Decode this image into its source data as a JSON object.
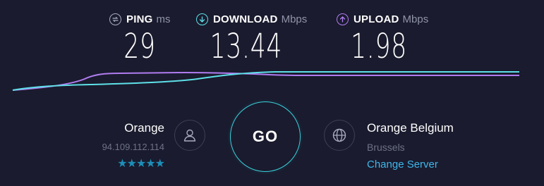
{
  "colors": {
    "background": "#1a1b2e",
    "ping_icon": "#a9abbf",
    "download_accent": "#5ee0e8",
    "upload_accent": "#b07cf0",
    "go_ring": "#3ad0dc",
    "link": "#3fb7ea",
    "stars": "#1c8fb8"
  },
  "metrics": {
    "ping": {
      "label": "PING",
      "unit": "ms",
      "value": "29",
      "icon": "ping-icon"
    },
    "download": {
      "label": "DOWNLOAD",
      "unit": "Mbps",
      "value": "13.44",
      "icon": "download-arrow-icon"
    },
    "upload": {
      "label": "UPLOAD",
      "unit": "Mbps",
      "value": "1.98",
      "icon": "upload-arrow-icon"
    }
  },
  "isp": {
    "name": "Orange",
    "ip": "94.109.112.114",
    "rating": "★★★★★",
    "icon": "user-icon"
  },
  "go_label": "GO",
  "server": {
    "name": "Orange Belgium",
    "location": "Brussels",
    "change_label": "Change Server",
    "icon": "globe-icon"
  }
}
